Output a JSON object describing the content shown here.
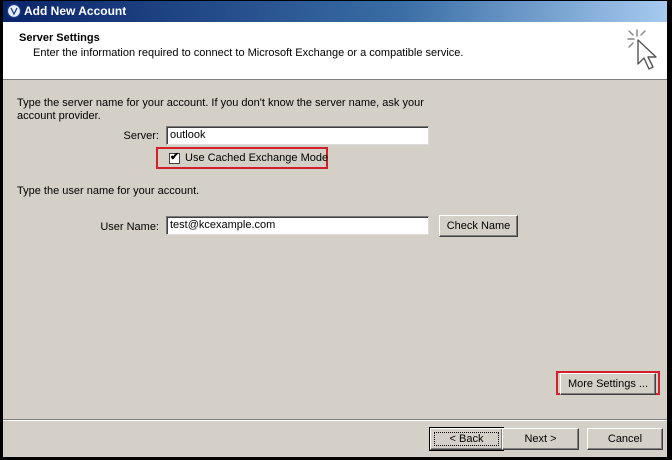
{
  "window": {
    "title": "Add New Account"
  },
  "header": {
    "title": "Server Settings",
    "subtitle": "Enter the information required to connect to Microsoft Exchange or a compatible service.",
    "icon": "cursor-click-icon"
  },
  "server_section": {
    "instruction": [
      "Type the server name for your account. If you don't know the server name, ask your",
      "account provider."
    ],
    "server_label": "Server:",
    "server_value": "outlook",
    "cached_mode_label": "Use Cached Exchange Mode",
    "cached_mode_checked": true
  },
  "user_section": {
    "instruction": "Type the user name for your account.",
    "username_label": "User Name:",
    "username_value": "test@kcexample.com",
    "check_name_label": "Check Name"
  },
  "more_settings_label": "More Settings ...",
  "footer": {
    "back_label": "< Back",
    "next_label": "Next >",
    "cancel_label": "Cancel"
  },
  "colors": {
    "highlight": "#d0212a",
    "dialog_bg": "#d4d0c8"
  }
}
